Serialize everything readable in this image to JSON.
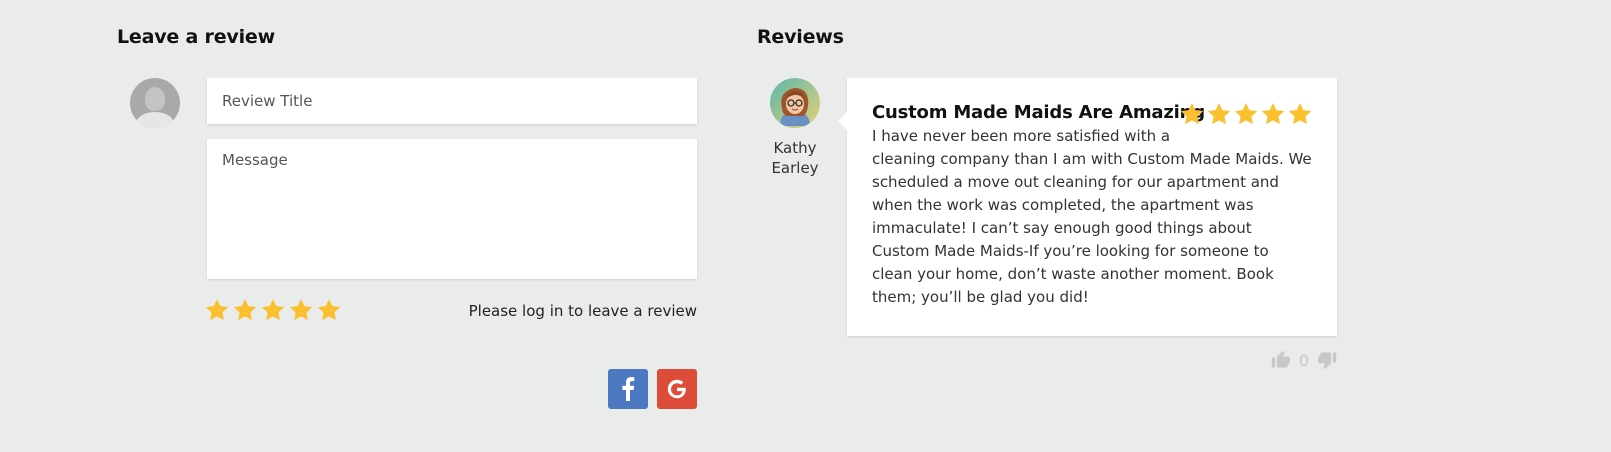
{
  "leave_review": {
    "heading": "Leave a review",
    "title_placeholder": "Review Title",
    "message_placeholder": "Message",
    "rating_stars": 5,
    "login_text": "Please log in to leave a review",
    "social": [
      "facebook-icon",
      "google-icon"
    ]
  },
  "reviews": {
    "heading": "Reviews",
    "items": [
      {
        "author": "Kathy\nEarley",
        "title": "Custom Made Maids Are Amazing",
        "rating": 5,
        "body": "I have never been more satisfied with a\ncleaning company than I am with Custom Made Maids. We scheduled a move out cleaning for our apartment and when the work was completed, the apartment was immaculate! I can’t say enough good things about Custom Made Maids-If you’re looking for someone to clean your home, don’t waste another moment. Book them; you’ll be glad you did!",
        "votes": "0"
      }
    ]
  },
  "colors": {
    "background": "#eaeceb",
    "star": "#fbc02d",
    "facebook": "#4b78c1",
    "google": "#dd4b39"
  }
}
